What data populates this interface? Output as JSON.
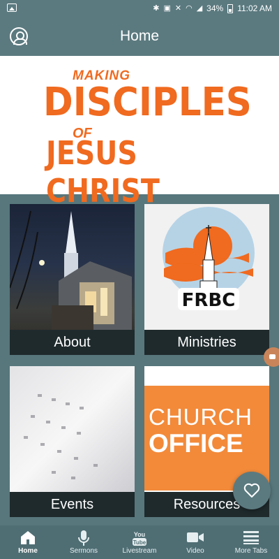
{
  "status_bar": {
    "battery": "34%",
    "time": "11:02 AM"
  },
  "app_bar": {
    "title": "Home"
  },
  "banner": {
    "line1": "MAKING",
    "line2": "DISCIPLES",
    "line3": "OF",
    "line4": "JESUS CHRIST"
  },
  "tiles": [
    {
      "label": "About"
    },
    {
      "label": "Ministries",
      "logo_text": "FRBC"
    },
    {
      "label": "Events"
    },
    {
      "label": "Resources",
      "image_text_1": "CHURCH",
      "image_text_2": "OFFICE"
    }
  ],
  "nav": [
    {
      "label": "Home",
      "icon": "home-icon",
      "active": true
    },
    {
      "label": "Sermons",
      "icon": "microphone-icon"
    },
    {
      "label": "Livestream",
      "icon": "youtube-icon"
    },
    {
      "label": "Video",
      "icon": "video-camera-icon"
    },
    {
      "label": "More Tabs",
      "icon": "menu-icon"
    }
  ],
  "colors": {
    "brand": "#5b7a80",
    "accent": "#f06a1f",
    "tile_label_bg": "#1f2a2d"
  }
}
